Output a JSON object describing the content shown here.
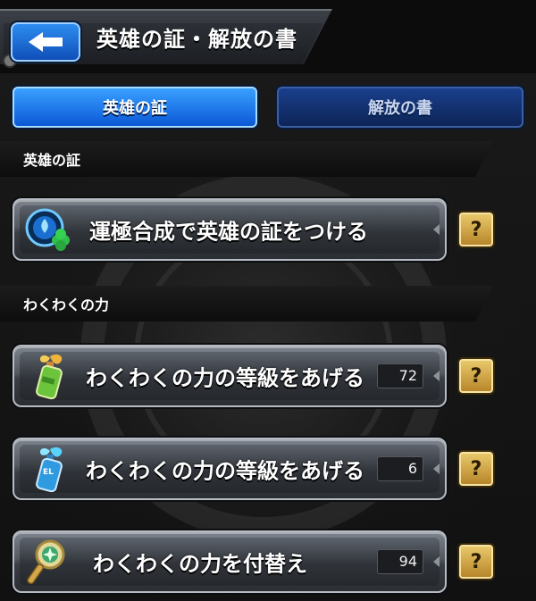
{
  "header": {
    "title": "英雄の証・解放の書",
    "back_icon": "back-arrow-icon"
  },
  "tabs": [
    {
      "label": "英雄の証",
      "active": true
    },
    {
      "label": "解放の書",
      "active": false
    }
  ],
  "sections": {
    "hero_proof": {
      "title": "英雄の証",
      "actions": [
        {
          "label": "運極合成で英雄の証をつける",
          "icon": "hero-proof-clover-icon",
          "help": "?"
        }
      ]
    },
    "wakuwaku": {
      "title": "わくわくの力",
      "actions": [
        {
          "label": "わくわくの力の等級をあげる",
          "count": "72",
          "icon": "green-growth-bottle-icon",
          "help": "?"
        },
        {
          "label": "わくわくの力の等級をあげる",
          "count": "6",
          "icon": "blue-el-bottle-icon",
          "help": "?"
        },
        {
          "label": "わくわくの力を付替え",
          "count": "94",
          "icon": "magic-wand-icon",
          "help": "?"
        }
      ]
    }
  },
  "colors": {
    "tab_active": "#1a78f0",
    "tab_inactive": "#16377e",
    "help_button": "#d4a84a",
    "background": "#141414"
  }
}
